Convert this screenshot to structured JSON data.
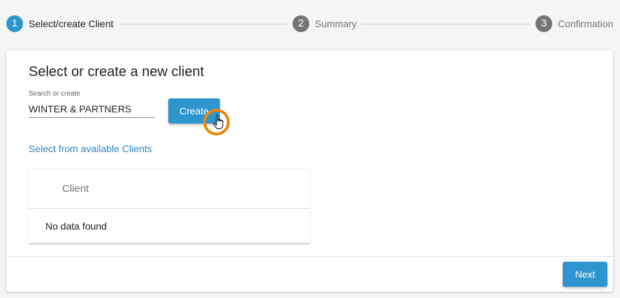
{
  "stepper": {
    "steps": [
      {
        "number": "1",
        "label": "Select/create Client",
        "state": "active"
      },
      {
        "number": "2",
        "label": "Summary",
        "state": "inactive"
      },
      {
        "number": "3",
        "label": "Confirmation",
        "state": "inactive"
      }
    ]
  },
  "card": {
    "title": "Select or create a new client",
    "search": {
      "label": "Search or create",
      "value": "WINTER & PARTNERS"
    },
    "create_label": "Create",
    "select_link": "Select from available Clients",
    "table": {
      "column_header": "Client",
      "empty_text": "No data found"
    },
    "next_label": "Next"
  },
  "colors": {
    "accent": "#2e96ce",
    "step_inactive": "#757575",
    "cursor_highlight": "#ee8305"
  },
  "icons": {
    "cursor": "hand-pointer-icon"
  }
}
